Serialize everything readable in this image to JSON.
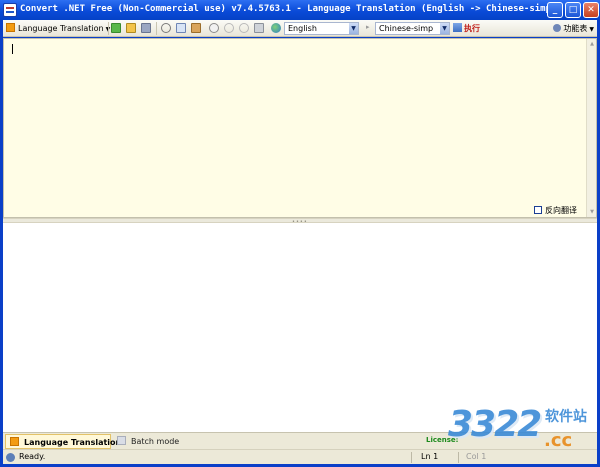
{
  "window": {
    "title": "Convert .NET Free (Non-Commercial use) v7.4.5763.1 - Language Translation (English -> Chinese-simp)"
  },
  "toolbar": {
    "mode_label": "Language Translation",
    "source_language": "English",
    "target_language": "Chinese-simp",
    "execute_label": "执行",
    "functions_label": "功能表"
  },
  "editor": {
    "reverse_translate_label": "反向翻译",
    "reverse_translate_checked": false
  },
  "tabs": [
    {
      "label": "Language Translation",
      "active": true
    },
    {
      "label": "Batch mode",
      "active": false
    }
  ],
  "tabbar": {
    "license_label": "License:"
  },
  "status": {
    "text": "Ready.",
    "line": "Ln 1",
    "col": "Col 1"
  },
  "watermark": {
    "digits": "3322",
    "cn": "软件站",
    "domain": ".cc"
  },
  "colors": {
    "titlebar": "#0a4bd8",
    "editor_bg": "#fffde6",
    "execute_text": "#c0201a",
    "license_text": "#1d8a1d"
  }
}
